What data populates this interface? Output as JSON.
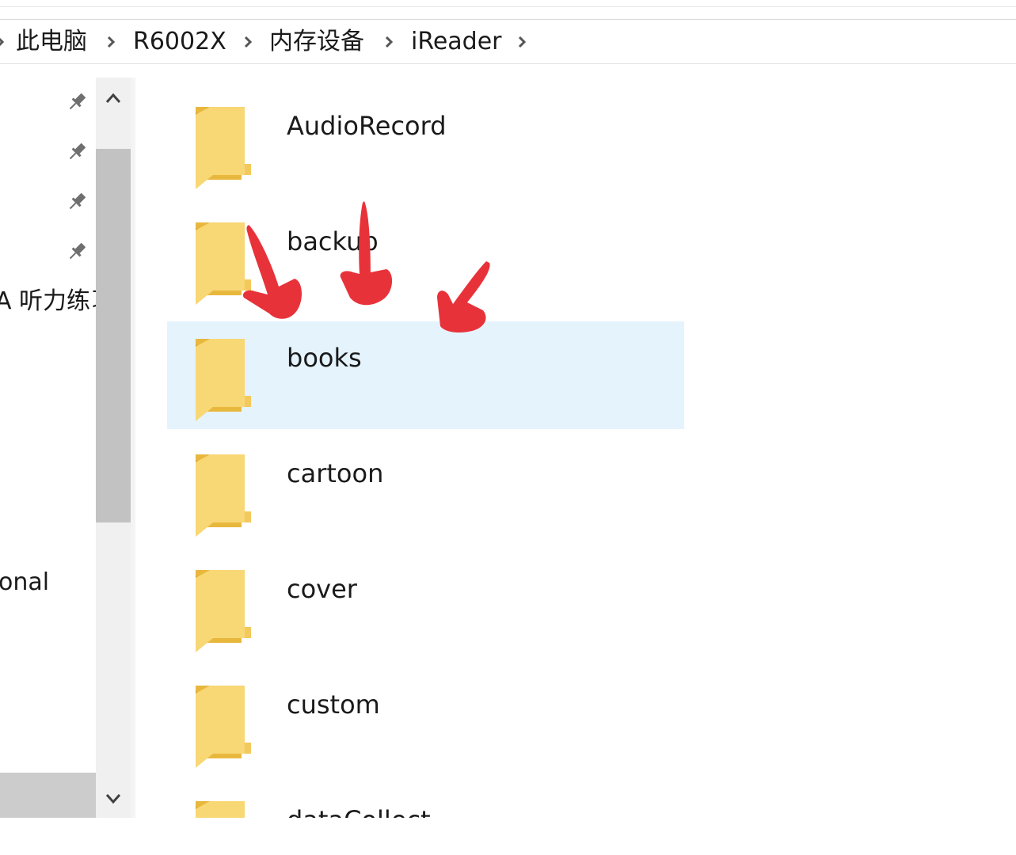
{
  "breadcrumb": {
    "items": [
      {
        "label": "此电脑"
      },
      {
        "label": "R6002X"
      },
      {
        "label": "内存设备"
      },
      {
        "label": "iReader"
      }
    ]
  },
  "nav_pane": {
    "partial_items": [
      {
        "label": "A 听力练习"
      },
      {
        "label": "onal"
      }
    ],
    "pinned_icon": "pin-icon"
  },
  "folders": [
    {
      "name": "AudioRecord",
      "selected": false
    },
    {
      "name": "backup",
      "selected": false
    },
    {
      "name": "books",
      "selected": true
    },
    {
      "name": "cartoon",
      "selected": false
    },
    {
      "name": "cover",
      "selected": false
    },
    {
      "name": "custom",
      "selected": false
    },
    {
      "name": "dataCollect",
      "selected": false
    }
  ],
  "colors": {
    "selection": "#e5f3fd",
    "folder_front": "#f8d775",
    "folder_back": "#e8b83e",
    "annotation_arrow": "#e8323a",
    "scroll_thumb": "#c2c2c2"
  },
  "icons": {
    "separator": "chevron-right-icon",
    "folder": "folder-icon",
    "scroll_up": "chevron-up-icon",
    "scroll_down": "chevron-down-icon"
  }
}
